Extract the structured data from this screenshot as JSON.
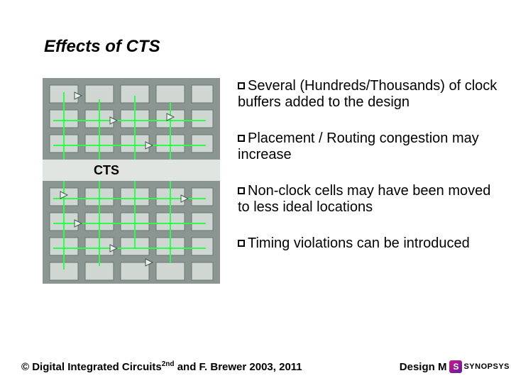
{
  "slide": {
    "title": "Effects of CTS",
    "bullets": [
      "Several (Hundreds/Thousands) of clock buffers added to the design",
      "Placement / Routing congestion may increase",
      "Non-clock cells may have been moved to less ideal locations",
      "Timing violations can be introduced"
    ],
    "diagram_label": "CTS",
    "footer_left_pre": "© Digital Integrated Circuits",
    "footer_left_sup": "2nd",
    "footer_left_post": " and F. Brewer 2003, 2011",
    "footer_right": "Design M",
    "logo_letter": "S",
    "logo_text": "SYNOPSYS"
  }
}
